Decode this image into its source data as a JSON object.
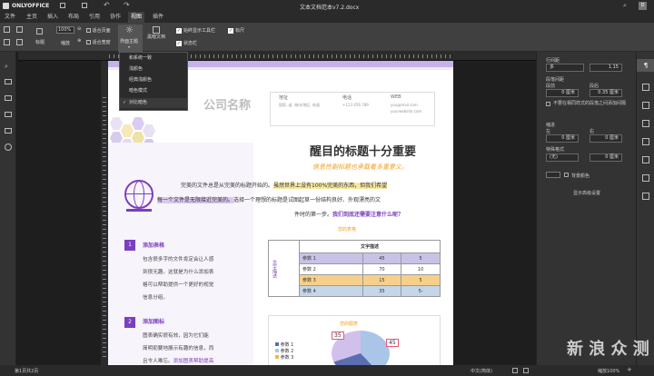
{
  "app": {
    "brand": "ONLYOFFICE",
    "doc_title": "文本文档范本v7.2.docx"
  },
  "tabs": [
    "文件",
    "主页",
    "插入",
    "布局",
    "引用",
    "协作",
    "视图",
    "插件"
  ],
  "toolbar": {
    "heading_label": "标题",
    "zoom_value": "100%",
    "zoom_label": "缩放",
    "fit_page": "适合页面",
    "fit_width": "适合宽度",
    "theme_label": "界面主题",
    "dark_doc_label": "黑暗文档",
    "always_show_toolbar": "始终显示工具栏",
    "status_bar": "状态栏",
    "ruler": "标尺"
  },
  "theme_menu": {
    "items": [
      "和系统一致",
      "浅颜色",
      "经典浅颜色",
      "暗色模式",
      "对比暗色"
    ],
    "checked_index": 4
  },
  "document": {
    "company": "公司名称",
    "addr_label": "地址",
    "addr_value": "国家, 省, 城市/地区, 街道",
    "phone_label": "电话",
    "phone_value": "+123 456 789",
    "web_label": "WEB",
    "web_value1": "you@mail.com",
    "web_value2": "yourwebsite.com",
    "headline": "醒目的标题十分重要",
    "subheadline": "信息性副标题也承载着多重意义。",
    "intro_a": "完美的文件总是从完美的标题开始的。",
    "intro_b": "虽然世界上没有100%完美的东西，但我们希望",
    "intro_c": "每一个文件是无限接近完美的。",
    "intro_d": "选择一个理想的标题是试图起草一份结构良好、外观漂亮的文",
    "intro_e": "件时的第一步。",
    "intro_link": "我们到底还需要注意什么呢？",
    "s1_num": "1",
    "s1_title": "添加表格",
    "s1_lines": [
      "包含很多字的文件肯定会让人感",
      "到很无趣。这就是为什么添加表",
      "格可以帮助提供一个更好的视觉",
      "信息分组。"
    ],
    "s2_num": "2",
    "s2_title": "添加图标",
    "s2_lines": [
      "图表确实很有效，因为它们能",
      "简明扼要地展示有趣的信息，而",
      "且令人难忘。"
    ],
    "s2_link": "添加图表帮助提高",
    "table_title": "您的表格",
    "table_header": "文字描述",
    "table_side": "文字描述",
    "table_rows": [
      [
        "参数 1",
        "45",
        "5"
      ],
      [
        "参数 2",
        "70",
        "10"
      ],
      [
        "参数 3",
        "15",
        "5"
      ],
      [
        "参数 4",
        "35",
        "5-"
      ]
    ],
    "chart_title": "您的图表",
    "chart_legend": [
      "参数 1",
      "参数 2",
      "参数 3"
    ],
    "chart_labels": [
      "35",
      "45"
    ]
  },
  "panel": {
    "line_spacing": "行间距",
    "line_mode": "多",
    "line_value": "1.15",
    "para_spacing": "段落间距",
    "before": "段前",
    "after": "段后",
    "before_value": "0 厘米",
    "after_value": "0.35 厘米",
    "no_space_same": "不要在相同样式的段落之间添加间隔",
    "indent": "缩进",
    "left": "左",
    "right": "右",
    "left_value": "0 厘米",
    "right_value": "0 厘米",
    "special": "特殊格式",
    "special_value": "(无)",
    "special_num": "0 厘米",
    "bg_color": "背景颜色",
    "advanced": "显示高级设置"
  },
  "status": {
    "page": "第1页共2页",
    "lang": "中文(简体)",
    "zoom": "缩放100%"
  },
  "colors": {
    "accent": "#7b3fbf",
    "orange": "#f0a020",
    "yellow": "#f7e8a0",
    "lavender": "#d8c8ef"
  },
  "watermark": "新 浪 众 测"
}
